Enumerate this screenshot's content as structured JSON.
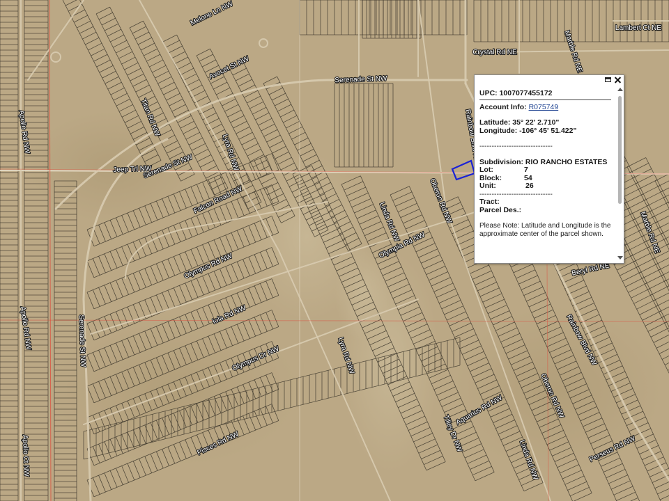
{
  "map": {
    "streets": [
      {
        "name": "Melone Ln NW"
      },
      {
        "name": "Avocet St NW"
      },
      {
        "name": "Serenade St NW"
      },
      {
        "name": "Crystal Rd NE"
      },
      {
        "name": "Lambert Ct NE"
      },
      {
        "name": "Marble Rd NE"
      },
      {
        "name": "Jeep Trl NW"
      },
      {
        "name": "Serenade St NW"
      },
      {
        "name": "Falcon Road NW"
      },
      {
        "name": "Lyra Rd NW"
      },
      {
        "name": "Titan Rd NW"
      },
      {
        "name": "Apollo Rd NW"
      },
      {
        "name": "Oberon Rd NW"
      },
      {
        "name": "Olympia Rd NW"
      },
      {
        "name": "Linda Rd NW"
      },
      {
        "name": "Rainbow Blvd NE"
      },
      {
        "name": "Olympus Rd NW"
      },
      {
        "name": "Iola Rd NW"
      },
      {
        "name": "Olympus Dr NW"
      },
      {
        "name": "Lyra Rd NW"
      },
      {
        "name": "Serenade St NW"
      },
      {
        "name": "Apollo Rd NW"
      },
      {
        "name": "Pisces Rd NW"
      },
      {
        "name": "Aquarius Rd NW"
      },
      {
        "name": "Tilley Dr NW"
      },
      {
        "name": "Oberon Rd NW"
      },
      {
        "name": "Linda Rd NW"
      },
      {
        "name": "Rainbow Blvd NW"
      },
      {
        "name": "Perseus Rd NW"
      },
      {
        "name": "Beryl Rd NE"
      },
      {
        "name": "Marble Rd NE"
      },
      {
        "name": "Apollo Ct NW"
      }
    ],
    "colors": {
      "ground": "#bba885",
      "parcel_line": "#3f3a2e",
      "road": "#d8cbb0",
      "grid_line": "#e04a3a",
      "selected_parcel": "#1a22d6"
    }
  },
  "popup": {
    "upc_label": "UPC:",
    "upc_value": "1007077455172",
    "account_label": "Account Info:",
    "account_link": "R075749",
    "latitude": "Latitude: 35° 22' 2.710\"",
    "longitude": "Longitude: -106° 45' 51.422\"",
    "divider": "------------------------------",
    "subdivision": "Subdivision: RIO RANCHO ESTATES",
    "lot_label": "Lot:",
    "lot_value": "7",
    "block_label": "Block:",
    "block_value": "54",
    "unit_label": "Unit:",
    "unit_value": "26",
    "divider2": "------------------------------",
    "tract_label": "Tract:",
    "parcel_label": "Parcel Des.:",
    "note": "Please Note: Latitude and Longitude is the approximate center of the parcel shown."
  }
}
